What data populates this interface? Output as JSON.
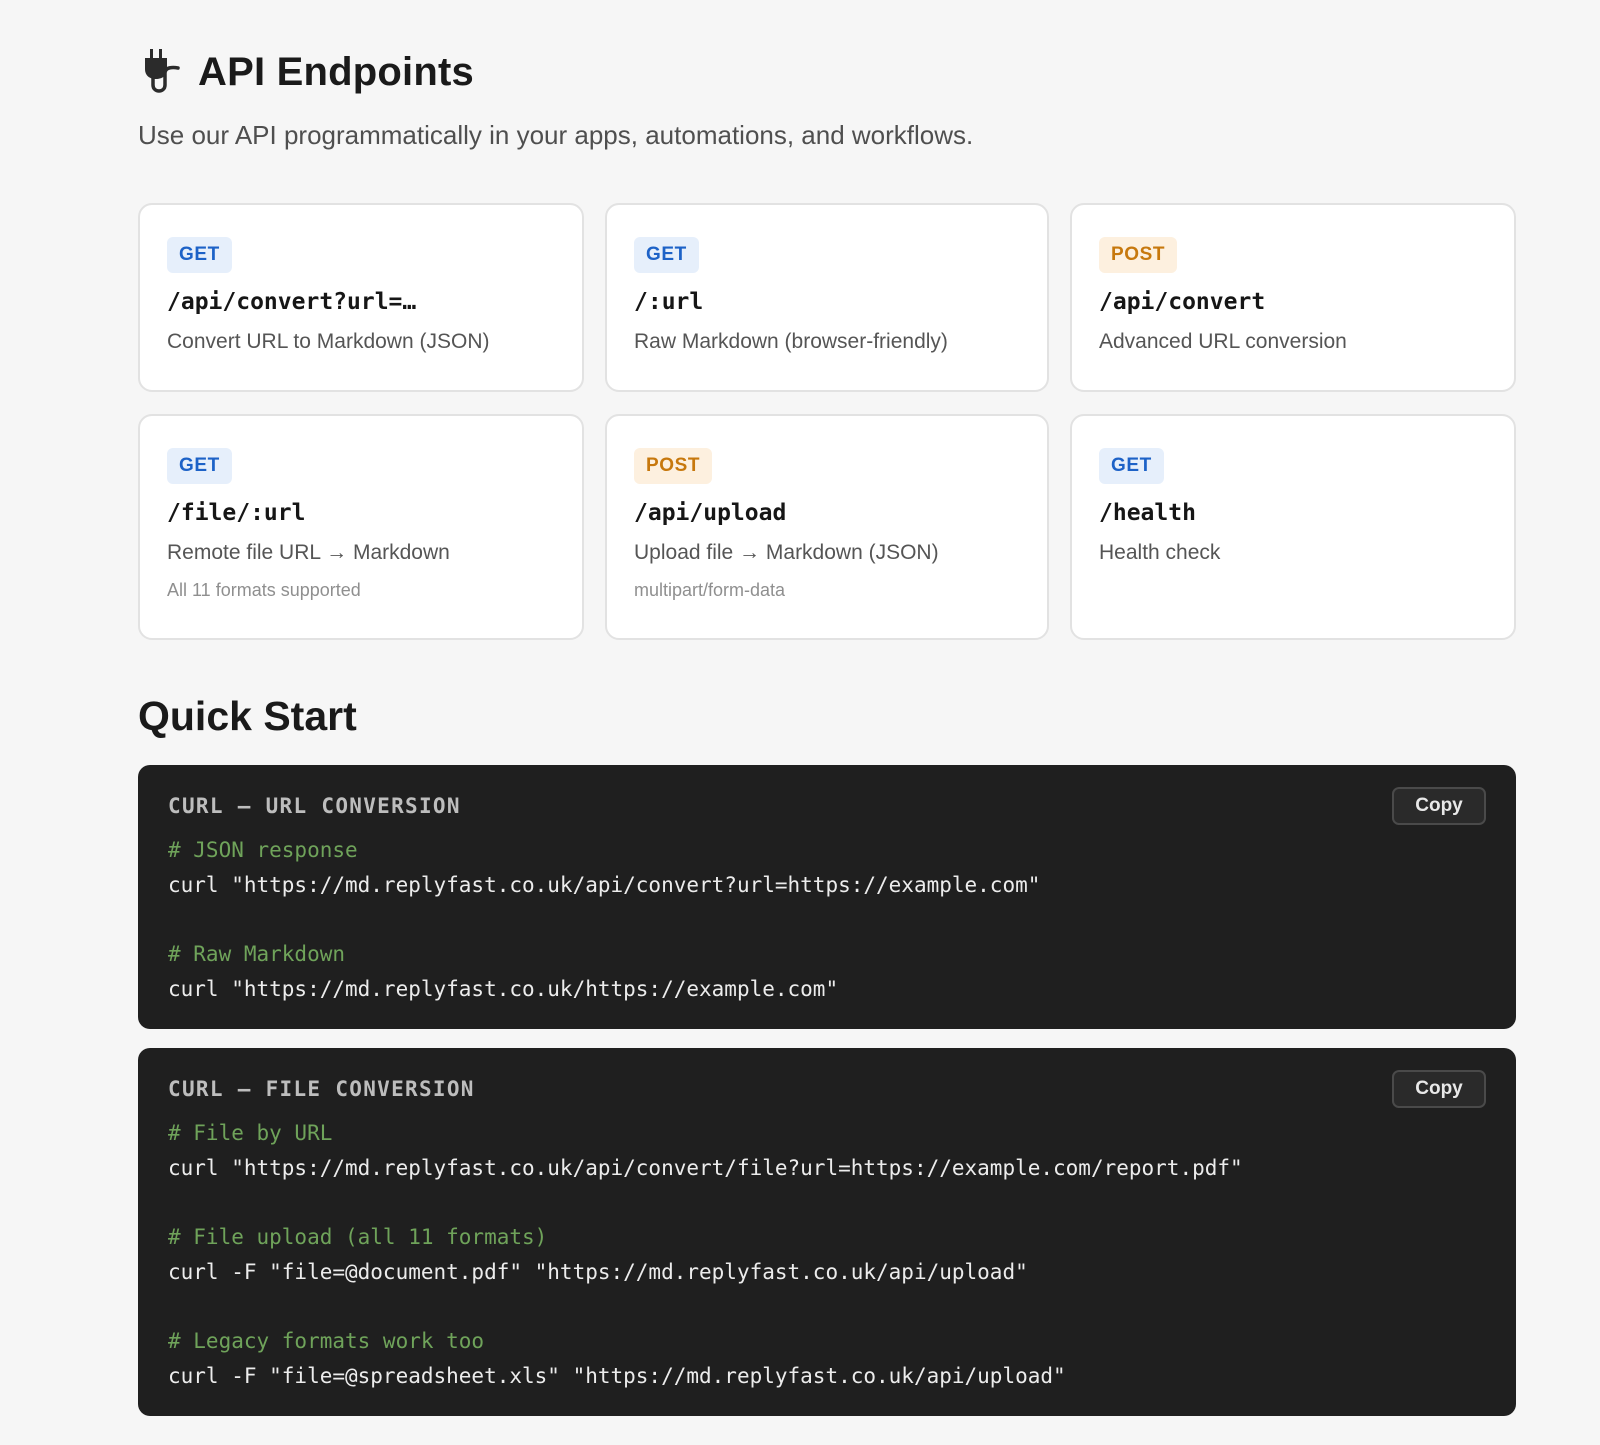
{
  "header": {
    "title": "API Endpoints",
    "subtitle": "Use our API programmatically in your apps, automations, and workflows.",
    "icon": "plug-icon"
  },
  "endpoints": [
    {
      "method": "GET",
      "path": "/api/convert?url=…",
      "desc": "Convert URL to Markdown (JSON)",
      "note": ""
    },
    {
      "method": "GET",
      "path": "/:url",
      "desc": "Raw Markdown (browser-friendly)",
      "note": ""
    },
    {
      "method": "POST",
      "path": "/api/convert",
      "desc": "Advanced URL conversion",
      "note": ""
    },
    {
      "method": "GET",
      "path": "/file/:url",
      "desc": "Remote file URL → Markdown",
      "note": "All 11 formats supported"
    },
    {
      "method": "POST",
      "path": "/api/upload",
      "desc": "Upload file → Markdown (JSON)",
      "note": "multipart/form-data"
    },
    {
      "method": "GET",
      "path": "/health",
      "desc": "Health check",
      "note": ""
    }
  ],
  "quickstart": {
    "title": "Quick Start",
    "blocks": [
      {
        "title": "CURL — URL CONVERSION",
        "copy_label": "Copy",
        "lines": [
          {
            "type": "comment",
            "text": "# JSON response"
          },
          {
            "type": "cmd",
            "text": "curl \"https://md.replyfast.co.uk/api/convert?url=https://example.com\""
          },
          {
            "type": "gap",
            "text": ""
          },
          {
            "type": "comment",
            "text": "# Raw Markdown"
          },
          {
            "type": "cmd",
            "text": "curl \"https://md.replyfast.co.uk/https://example.com\""
          }
        ]
      },
      {
        "title": "CURL — FILE CONVERSION",
        "copy_label": "Copy",
        "lines": [
          {
            "type": "comment",
            "text": "# File by URL"
          },
          {
            "type": "cmd",
            "text": "curl \"https://md.replyfast.co.uk/api/convert/file?url=https://example.com/report.pdf\""
          },
          {
            "type": "gap",
            "text": ""
          },
          {
            "type": "comment",
            "text": "# File upload (all 11 formats)"
          },
          {
            "type": "cmd",
            "text": "curl -F \"file=@document.pdf\" \"https://md.replyfast.co.uk/api/upload\""
          },
          {
            "type": "gap",
            "text": ""
          },
          {
            "type": "comment",
            "text": "# Legacy formats work too"
          },
          {
            "type": "cmd",
            "text": "curl -F \"file=@spreadsheet.xls\" \"https://md.replyfast.co.uk/api/upload\""
          }
        ]
      }
    ]
  },
  "colors": {
    "get_badge": "#1d62c7",
    "post_badge": "#c7780d",
    "code_bg": "#1f1f1f",
    "comment": "#6fa35a"
  }
}
